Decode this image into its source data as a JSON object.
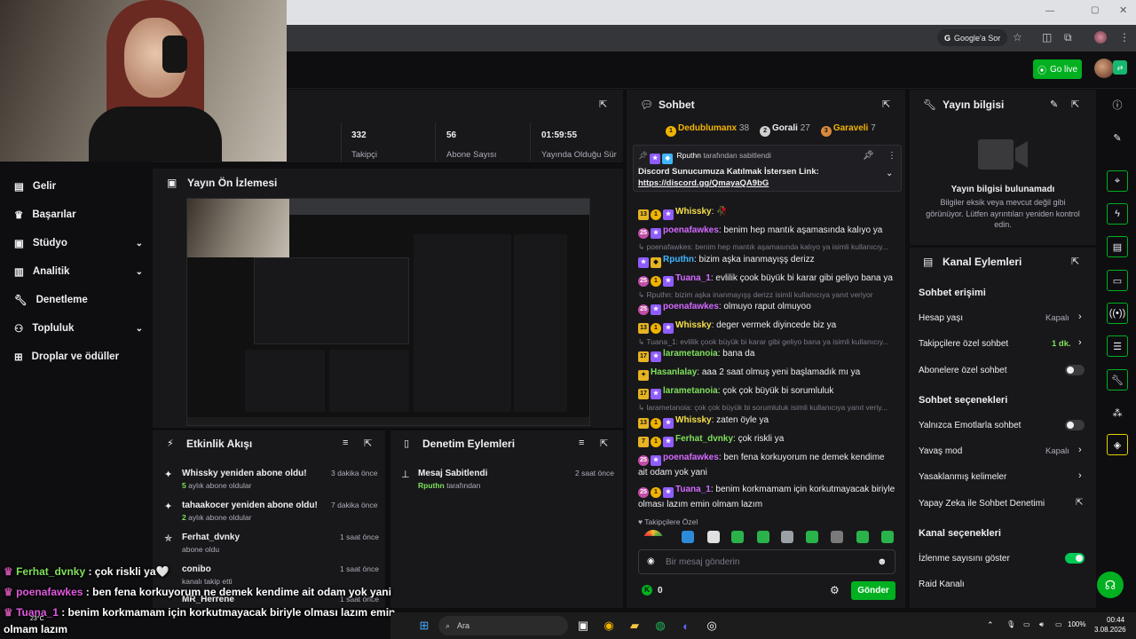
{
  "browser": {
    "google_ask": "Google'a Sor"
  },
  "header": {
    "go_live": "Go live"
  },
  "nav": {
    "items": [
      {
        "label": "Gelir",
        "icon": "credit-card-icon"
      },
      {
        "label": "Başarılar",
        "icon": "trophy-icon"
      },
      {
        "label": "Stüdyo",
        "icon": "studio-icon",
        "expandable": true
      },
      {
        "label": "Analitik",
        "icon": "chart-icon",
        "expandable": true
      },
      {
        "label": "Denetleme",
        "icon": "wrench-icon"
      },
      {
        "label": "Topluluk",
        "icon": "people-icon",
        "expandable": true
      },
      {
        "label": "Droplar ve ödüller",
        "icon": "gift-icon"
      }
    ]
  },
  "stats": {
    "followers_value": "332",
    "followers_label": "Takipçi",
    "subs_value": "56",
    "subs_label": "Abone Sayısı",
    "uptime_value": "01:59:55",
    "uptime_label": "Yayında Olduğu Süre"
  },
  "preview": {
    "title": "Yayın Ön İzlemesi"
  },
  "activity": {
    "title": "Etkinlik Akışı",
    "items": [
      {
        "title": "Whissky yeniden abone oldu!",
        "sub_num": "5",
        "sub": " aylık abone oldular",
        "time": "3 dakika önce"
      },
      {
        "title": "tahaakocer yeniden abone oldu!",
        "sub_num": "2",
        "sub": " aylık abone oldular",
        "time": "7 dakika önce"
      },
      {
        "title": "Ferhat_dvnky",
        "sub_num": "",
        "sub": "abone oldu",
        "time": "1 saat önce"
      },
      {
        "title": "conibo",
        "sub_num": "",
        "sub": "kanalı takip etti",
        "time": "1 saat önce"
      },
      {
        "title": "MR_Herrene",
        "sub_num": "",
        "sub": "",
        "time": "1 saat önce"
      }
    ]
  },
  "moderation": {
    "title": "Denetim Eylemleri",
    "items": [
      {
        "title": "Mesaj Sabitlendi",
        "user": "Rputhn",
        "by": " tarafından",
        "time": "2 saat önce"
      }
    ]
  },
  "chat": {
    "title": "Sohbet",
    "leaderboard": [
      {
        "rank": "1",
        "name": "Dedublumanx",
        "score": "38",
        "color": "#f5b400"
      },
      {
        "rank": "2",
        "name": "Gorali",
        "score": "27",
        "color": "#d0d0d0"
      },
      {
        "rank": "3",
        "name": "Garaveli",
        "score": "7",
        "color": "#d88a3c"
      }
    ],
    "pinned": {
      "user": "Rputhn",
      "by": " tarafından sabitlendi",
      "text": "Discord Sunucumuza Katılmak İstersen Link:",
      "link": "https://discord.gg/QmayaQA9bG"
    },
    "messages": [
      {
        "type": "msg",
        "badges": [
          "13",
          "1",
          "★"
        ],
        "user": "Whissky",
        "color": "#f5e04a",
        "text": ": 🥀"
      },
      {
        "type": "msg",
        "badges": [
          "25",
          "★"
        ],
        "user": "poenafawkes",
        "color": "#d46aff",
        "text": ": benim hep mantık aşamasında kalıyo ya"
      },
      {
        "type": "reply",
        "text": "↳ poenafawkes: benim hep mantık aşamasında kalıyo ya isimli kullanıcıy..."
      },
      {
        "type": "msg",
        "badges": [
          "★",
          "◆"
        ],
        "user": "Rputhn",
        "color": "#3fb7ff",
        "text": ": bizim aşka inanmayışş derizz"
      },
      {
        "type": "msg",
        "badges": [
          "25",
          "1",
          "★"
        ],
        "user": "Tuana_1",
        "color": "#d46aff",
        "text": ": evlilik çook büyük bi karar gibi geliyo bana ya"
      },
      {
        "type": "reply",
        "text": "↳ Rputhn: bizim aşka inanmayışş derizz isimli kullanıcıya yanıt veriyor"
      },
      {
        "type": "msg",
        "badges": [
          "25",
          "★"
        ],
        "user": "poenafawkes",
        "color": "#d46aff",
        "text": ": olmuyo raput olmuyoo"
      },
      {
        "type": "msg",
        "badges": [
          "13",
          "1",
          "★"
        ],
        "user": "Whissky",
        "color": "#f5e04a",
        "text": ": deger vermek diyincede biz ya"
      },
      {
        "type": "reply",
        "text": "↳ Tuana_1: evlilik çook büyük bi karar gibi geliyo bana ya isimli kullanıcıy..."
      },
      {
        "type": "msg",
        "badges": [
          "17",
          "★"
        ],
        "user": "larametanoia",
        "color": "#7fe05a",
        "text": ": bana da"
      },
      {
        "type": "msg",
        "badges": [
          "✦"
        ],
        "user": "Hasanlalay",
        "color": "#7fe05a",
        "text": ": aaa 2 saat olmuş yeni başlamadık mı ya"
      },
      {
        "type": "msg",
        "badges": [
          "17",
          "★"
        ],
        "user": "larametanoia",
        "color": "#7fe05a",
        "text": ": çok çok büyük bi sorumluluk"
      },
      {
        "type": "reply",
        "text": "↳ larametanoia: çok çok büyük bi sorumluluk isimli kullanıcıya yanıt veriy..."
      },
      {
        "type": "msg",
        "badges": [
          "13",
          "1",
          "★"
        ],
        "user": "Whissky",
        "color": "#f5e04a",
        "text": ": zaten öyle ya"
      },
      {
        "type": "msg",
        "badges": [
          "7",
          "1",
          "★"
        ],
        "user": "Ferhat_dvnky",
        "color": "#7fe05a",
        "text": ": çok riskli ya"
      },
      {
        "type": "msg2",
        "badges": [
          "25",
          "★"
        ],
        "user": "poenafawkes",
        "color": "#d46aff",
        "text": ": ben fena korkuyorum ne demek kendime ait odam yok yani"
      },
      {
        "type": "msg2",
        "badges": [
          "25",
          "1",
          "★"
        ],
        "user": "Tuana_1",
        "color": "#d46aff",
        "text": ": benim korkmamam için korkutmayacak biriyle olması lazım emin olmam lazım"
      }
    ],
    "followers_only": "Takipçilere Özel",
    "input_placeholder": "Bir mesaj gönderin",
    "points": "0",
    "send": "Gönder"
  },
  "info": {
    "title": "Yayın bilgisi",
    "empty_title": "Yayın bilgisi bulunamadı",
    "empty_text": "Bilgiler eksik veya mevcut değil gibi görünüyor. Lütfen ayrıntıları yeniden kontrol edin."
  },
  "actions": {
    "title": "Kanal Eylemleri",
    "access_head": "Sohbet erişimi",
    "account_age": "Hesap yaşı",
    "account_age_val": "Kapalı",
    "followers_chat": "Takipçilere özel sohbet",
    "followers_chat_val": "1 dk.",
    "subs_chat": "Abonelere özel sohbet",
    "options_head": "Sohbet seçenekleri",
    "emote_only": "Yalnızca Emotlarla sohbet",
    "slow_mode": "Yavaş mod",
    "slow_mode_val": "Kapalı",
    "banned_words": "Yasaklanmış kelimeler",
    "ai_mod": "Yapay Zeka ile Sohbet Denetimi",
    "channel_head": "Kanal seçenekleri",
    "show_viewers": "İzlenme sayısını göster",
    "raid": "Raid Kanalı"
  },
  "overlay": {
    "lines": [
      {
        "user": "Ferhat_dvnky",
        "color": "#7fe05a",
        "text": " : çok riskli ya🤍"
      },
      {
        "user": "poenafawkes",
        "color": "#e05adf",
        "text": " : ben fena korkuyorum ne demek kendime ait odam yok yani"
      },
      {
        "user": "Tuana_1",
        "color": "#e05adf",
        "text": " : benim korkmamam için korkutmayacak biriyle olması lazım emin"
      }
    ],
    "wrap": "olmam lazım",
    "weather": "23°C"
  },
  "taskbar": {
    "search": "Ara",
    "battery": "100%",
    "time": "00:44",
    "date": "3.08.2026"
  },
  "colors": {
    "accent": "#00b020",
    "panel": "#18181b",
    "bg": "#0e0e10"
  }
}
